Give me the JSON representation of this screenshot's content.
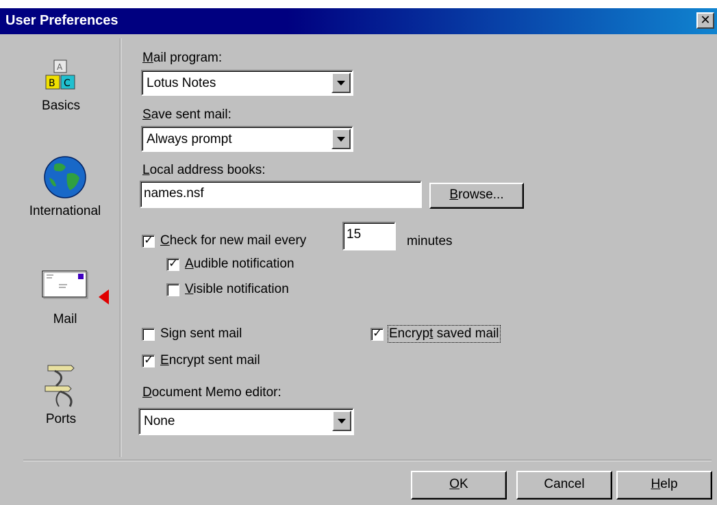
{
  "window": {
    "title": "User Preferences",
    "close_symbol": "✕"
  },
  "sidebar": {
    "items": [
      {
        "label": "Basics",
        "icon": "abc-blocks-icon"
      },
      {
        "label": "International",
        "icon": "globe-icon"
      },
      {
        "label": "Mail",
        "icon": "mail-envelope-icon",
        "selected": true
      },
      {
        "label": "Ports",
        "icon": "ports-connector-icon"
      }
    ]
  },
  "form": {
    "mail_program": {
      "label_accel": "M",
      "label_rest": "ail program:",
      "value": "Lotus Notes"
    },
    "save_sent_mail": {
      "label_accel": "S",
      "label_rest": "ave sent mail:",
      "value": "Always prompt"
    },
    "local_address_books": {
      "label_accel": "L",
      "label_rest": "ocal address books:",
      "value": "names.nsf"
    },
    "browse_button": {
      "accel": "B",
      "rest": "rowse..."
    },
    "check_new_mail": {
      "accel": "C",
      "rest": "heck for new mail every",
      "checked": true,
      "minutes_value": "15",
      "minutes_label": "minutes"
    },
    "audible_notification": {
      "accel": "A",
      "rest": "udible notification",
      "checked": true
    },
    "visible_notification": {
      "accel": "V",
      "rest": "isible notification",
      "checked": false
    },
    "sign_sent_mail": {
      "pre": "Si",
      "accel": "g",
      "rest": "n sent mail",
      "checked": false
    },
    "encrypt_saved_mail": {
      "pre": "Encryp",
      "accel": "t",
      "rest": " saved mail",
      "checked": true
    },
    "encrypt_sent_mail": {
      "accel": "E",
      "rest": "ncrypt sent mail",
      "checked": true
    },
    "document_memo_editor": {
      "label_accel": "D",
      "label_rest": "ocument Memo editor:",
      "value": "None"
    }
  },
  "buttons": {
    "ok": {
      "accel": "O",
      "rest": "K"
    },
    "cancel": {
      "label": "Cancel"
    },
    "help": {
      "accel": "H",
      "rest": "elp"
    }
  },
  "colors": {
    "titlebar": "#000080",
    "face": "#c0c0c0",
    "selection_arrow": "#e00000"
  }
}
